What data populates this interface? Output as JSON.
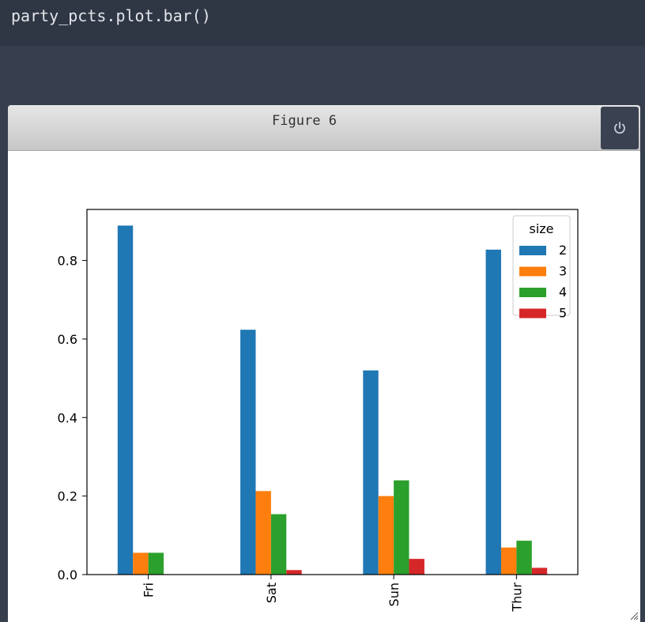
{
  "code": {
    "line": "party_pcts.plot.bar()"
  },
  "figure": {
    "title": "Figure 6",
    "close_icon": "power-icon"
  },
  "colors": {
    "series": [
      "#1f77b4",
      "#ff7f0e",
      "#2ca02c",
      "#d62728"
    ],
    "code_bg": "#2f3644",
    "output_bg": "#373f4e"
  },
  "chart_data": {
    "type": "bar",
    "categories": [
      "Fri",
      "Sat",
      "Sun",
      "Thur"
    ],
    "series": [
      {
        "name": "2",
        "values": [
          0.888889,
          0.623563,
          0.52,
          0.827586
        ]
      },
      {
        "name": "3",
        "values": [
          0.055556,
          0.212644,
          0.2,
          0.068966
        ]
      },
      {
        "name": "4",
        "values": [
          0.055556,
          0.153846,
          0.24,
          0.086207
        ]
      },
      {
        "name": "5",
        "values": [
          0.0,
          0.011494,
          0.04,
          0.017241
        ]
      }
    ],
    "legend_title": "size",
    "legend_position": "upper-right",
    "ylim": [
      0,
      0.93
    ],
    "yticks": [
      0.0,
      0.2,
      0.4,
      0.6,
      0.8
    ],
    "ytick_labels": [
      "0.0",
      "0.2",
      "0.4",
      "0.6",
      "0.8"
    ],
    "xtick_rotation": 90,
    "grid": false,
    "xlabel": "",
    "ylabel": ""
  }
}
